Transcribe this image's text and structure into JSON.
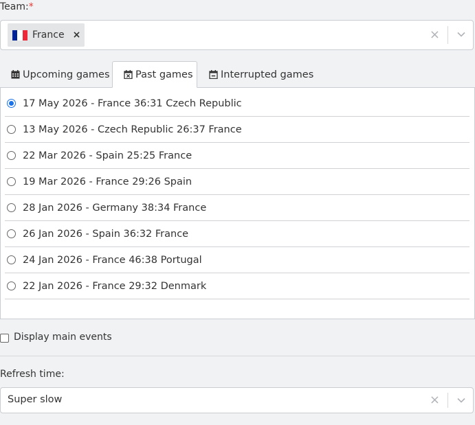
{
  "team": {
    "label": "Team:",
    "required_mark": "*",
    "selected": [
      {
        "name": "France",
        "flag_colors": [
          "#002395",
          "#ffffff",
          "#ed2939"
        ]
      }
    ],
    "remove_glyph": "×",
    "clear_glyph": "×"
  },
  "tabs": [
    {
      "label": "Upcoming games",
      "icon": "calendar-icon",
      "active": false
    },
    {
      "label": "Past games",
      "icon": "calendar-x-icon",
      "active": true
    },
    {
      "label": "Interrupted games",
      "icon": "calendar-minus-icon",
      "active": false
    }
  ],
  "games": [
    {
      "label": "17 May 2026 - France 36:31 Czech Republic",
      "selected": true
    },
    {
      "label": "13 May 2026 - Czech Republic 26:37 France",
      "selected": false
    },
    {
      "label": "22 Mar 2026 - Spain 25:25 France",
      "selected": false
    },
    {
      "label": "19 Mar 2026 - France 29:26 Spain",
      "selected": false
    },
    {
      "label": "28 Jan 2026 - Germany 38:34 France",
      "selected": false
    },
    {
      "label": "26 Jan 2026 - Spain 36:32 France",
      "selected": false
    },
    {
      "label": "24 Jan 2026 - France 46:38 Portugal",
      "selected": false
    },
    {
      "label": "22 Jan 2026 - France 29:32 Denmark",
      "selected": false
    }
  ],
  "display_main_events": {
    "label": "Display main events",
    "checked": false
  },
  "refresh": {
    "label": "Refresh time:",
    "value": "Super slow",
    "clear_glyph": "×"
  },
  "colors": {
    "accent": "#1a73e8",
    "required": "#e53935",
    "background": "#f1f2f3"
  }
}
